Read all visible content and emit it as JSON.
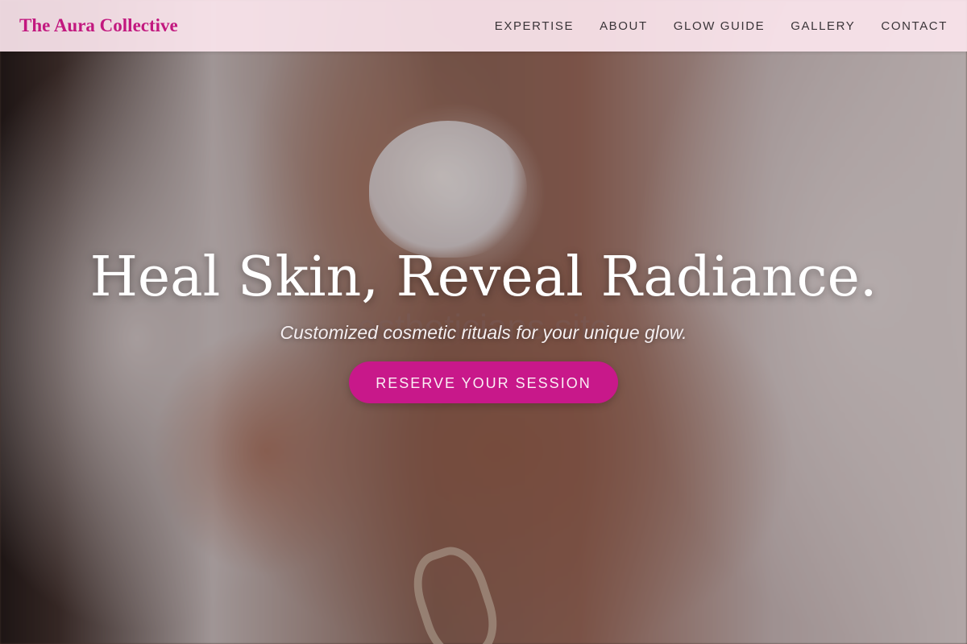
{
  "header": {
    "brand": "The Aura Collective",
    "nav": [
      {
        "label": "EXPERTISE"
      },
      {
        "label": "ABOUT"
      },
      {
        "label": "GLOW GUIDE"
      },
      {
        "label": "GALLERY"
      },
      {
        "label": "CONTACT"
      }
    ]
  },
  "hero": {
    "title": "Heal Skin, Reveal Radiance.",
    "subtitle": "Customized cosmetic rituals for your unique glow.",
    "cta_label": "RESERVE YOUR SESSION",
    "watermark": "estheticians.site",
    "background_image": "close-up of hands dispensing white lotion from a pump bottle"
  },
  "colors": {
    "brand": "#c2187f",
    "cta_background": "#c8188a",
    "header_background": "#fae4ec"
  }
}
